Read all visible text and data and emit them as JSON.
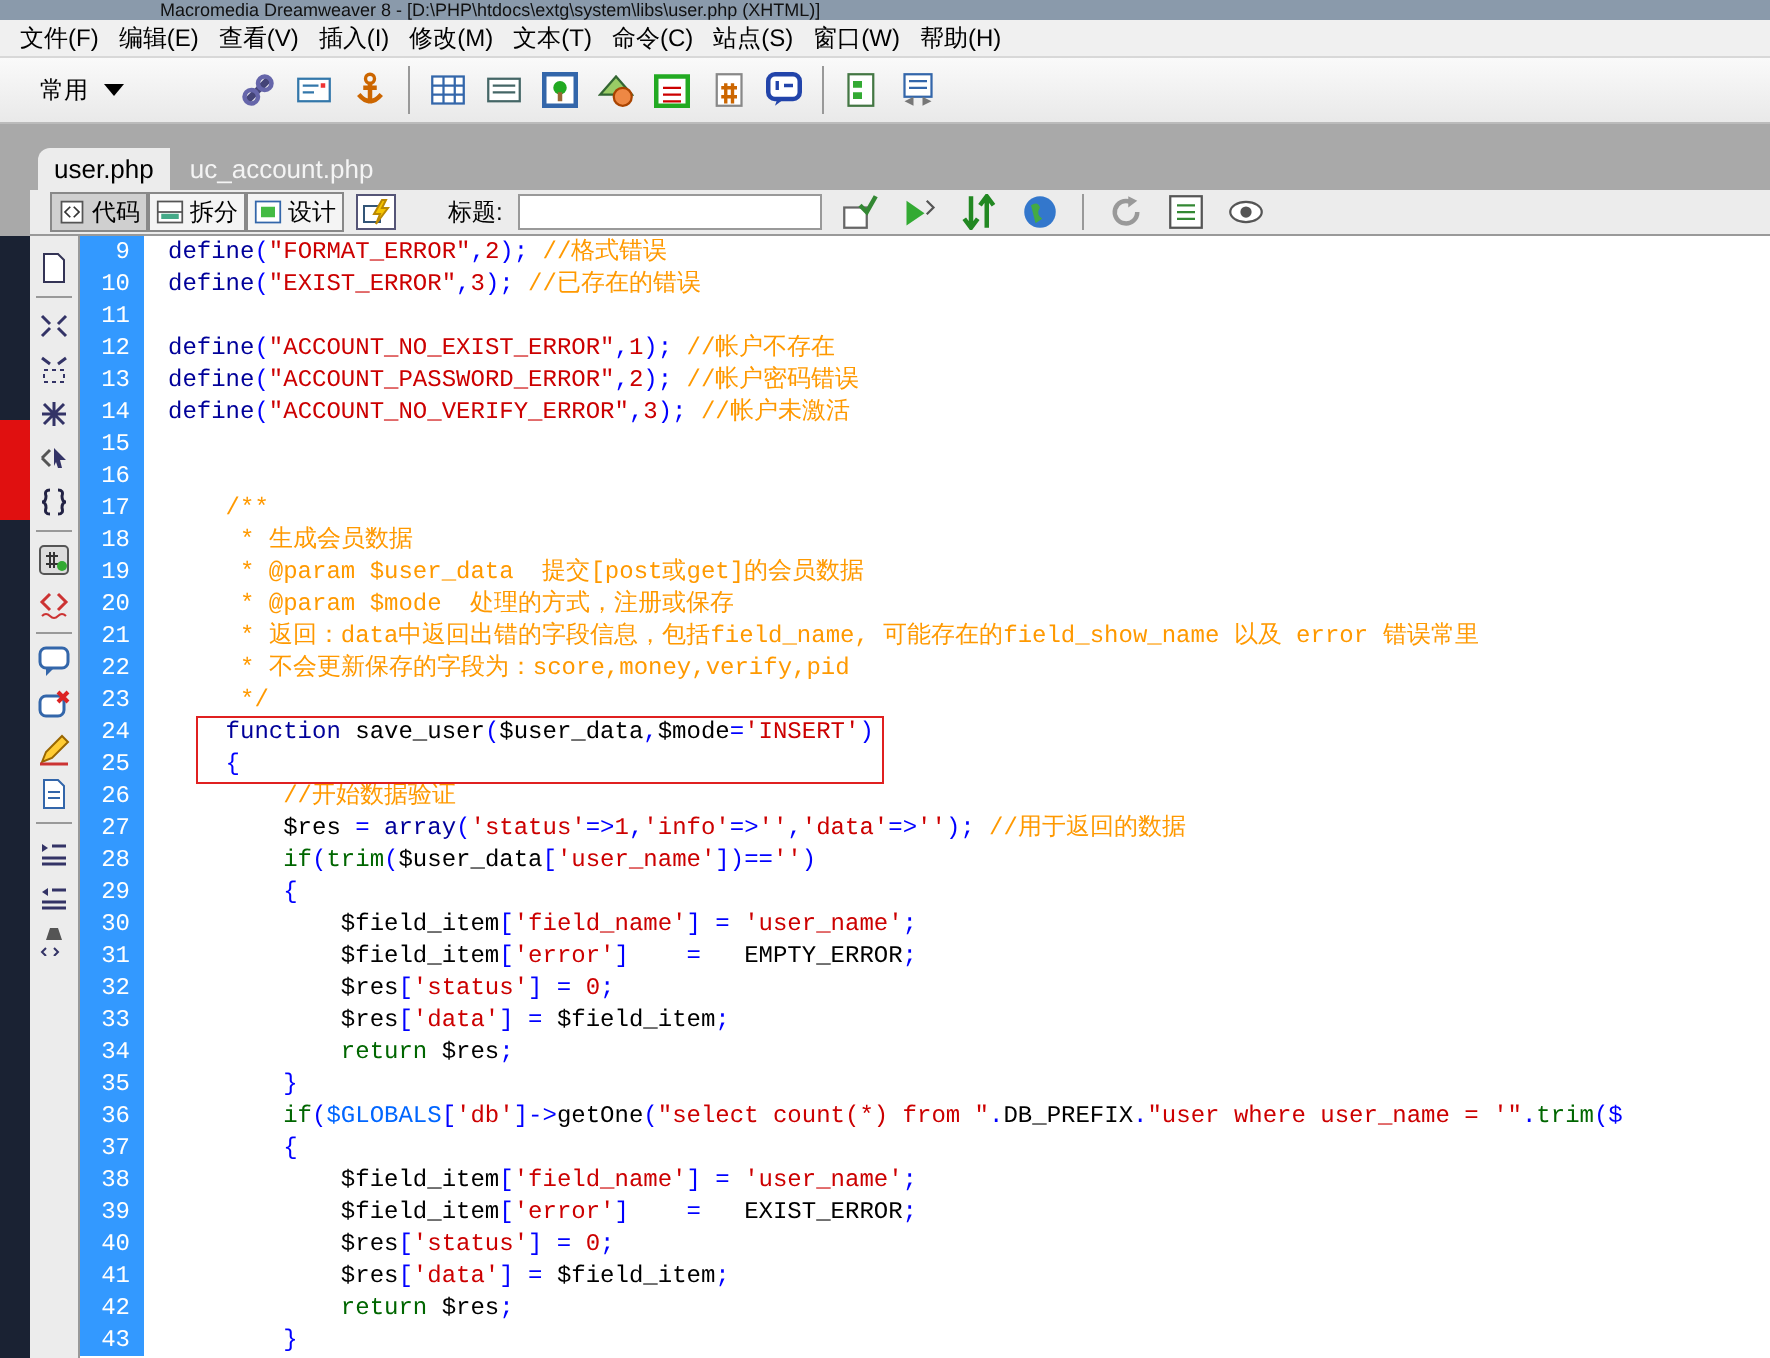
{
  "title_bar": {
    "title": "Macromedia Dreamweaver 8 - [D:\\PHP\\htdocs\\extg\\system\\libs\\user.php (XHTML)]"
  },
  "menu": [
    "文件(F)",
    "编辑(E)",
    "查看(V)",
    "插入(I)",
    "修改(M)",
    "文本(T)",
    "命令(C)",
    "站点(S)",
    "窗口(W)",
    "帮助(H)"
  ],
  "insert_bar": {
    "category": "常用"
  },
  "tabs": [
    {
      "label": "user.php",
      "selected": true
    },
    {
      "label": "uc_account.php",
      "selected": false
    }
  ],
  "view_buttons": [
    {
      "label": "代码",
      "selected": true
    },
    {
      "label": "拆分",
      "selected": false
    },
    {
      "label": "设计",
      "selected": false
    }
  ],
  "title_field": {
    "label": "标题:"
  },
  "code": {
    "lines": [
      {
        "number": "9",
        "tokens": [
          {
            "kind": "k",
            "text": "define"
          },
          {
            "kind": "p",
            "text": "("
          },
          {
            "kind": "s",
            "text": "\"FORMAT_ERROR\""
          },
          {
            "kind": "p",
            "text": ","
          },
          {
            "kind": "n",
            "text": "2"
          },
          {
            "kind": "p",
            "text": ");"
          },
          {
            "kind": "c",
            "text": " //格式错误"
          }
        ]
      },
      {
        "number": "10",
        "tokens": [
          {
            "kind": "k",
            "text": "define"
          },
          {
            "kind": "p",
            "text": "("
          },
          {
            "kind": "s",
            "text": "\"EXIST_ERROR\""
          },
          {
            "kind": "p",
            "text": ","
          },
          {
            "kind": "n",
            "text": "3"
          },
          {
            "kind": "p",
            "text": ");"
          },
          {
            "kind": "c",
            "text": " //已存在的错误"
          }
        ]
      },
      {
        "number": "11"
      },
      {
        "number": "12",
        "tokens": [
          {
            "kind": "k",
            "text": "define"
          },
          {
            "kind": "p",
            "text": "("
          },
          {
            "kind": "s",
            "text": "\"ACCOUNT_NO_EXIST_ERROR\""
          },
          {
            "kind": "p",
            "text": ","
          },
          {
            "kind": "n",
            "text": "1"
          },
          {
            "kind": "p",
            "text": ");"
          },
          {
            "kind": "c",
            "text": " //帐户不存在"
          }
        ]
      },
      {
        "number": "13",
        "tokens": [
          {
            "kind": "k",
            "text": "define"
          },
          {
            "kind": "p",
            "text": "("
          },
          {
            "kind": "s",
            "text": "\"ACCOUNT_PASSWORD_ERROR\""
          },
          {
            "kind": "p",
            "text": ","
          },
          {
            "kind": "n",
            "text": "2"
          },
          {
            "kind": "p",
            "text": ");"
          },
          {
            "kind": "c",
            "text": " //帐户密码错误"
          }
        ]
      },
      {
        "number": "14",
        "tokens": [
          {
            "kind": "k",
            "text": "define"
          },
          {
            "kind": "p",
            "text": "("
          },
          {
            "kind": "s",
            "text": "\"ACCOUNT_NO_VERIFY_ERROR\""
          },
          {
            "kind": "p",
            "text": ","
          },
          {
            "kind": "n",
            "text": "3"
          },
          {
            "kind": "p",
            "text": ");"
          },
          {
            "kind": "c",
            "text": " //帐户未激活"
          }
        ]
      },
      {
        "number": "15"
      },
      {
        "number": "16"
      },
      {
        "number": "17",
        "tokens": [
          {
            "kind": "c",
            "text": "    /**"
          }
        ]
      },
      {
        "number": "18",
        "tokens": [
          {
            "kind": "c",
            "text": "     * 生成会员数据"
          }
        ]
      },
      {
        "number": "19",
        "tokens": [
          {
            "kind": "c",
            "text": "     * @param $user_data  提交[post或get]的会员数据"
          }
        ]
      },
      {
        "number": "20",
        "tokens": [
          {
            "kind": "c",
            "text": "     * @param $mode  处理的方式，注册或保存"
          }
        ]
      },
      {
        "number": "21",
        "tokens": [
          {
            "kind": "c",
            "text": "     * 返回：data中返回出错的字段信息，包括field_name, 可能存在的field_show_name 以及 error 错误常里"
          }
        ]
      },
      {
        "number": "22",
        "tokens": [
          {
            "kind": "c",
            "text": "     * 不会更新保存的字段为：score,money,verify,pid"
          }
        ]
      },
      {
        "number": "23",
        "tokens": [
          {
            "kind": "c",
            "text": "     */"
          }
        ]
      },
      {
        "number": "24",
        "tokens": [
          {
            "kind": "k",
            "text": "    function"
          },
          {
            "kind": "t",
            "text": " save_user"
          },
          {
            "kind": "p",
            "text": "("
          },
          {
            "kind": "t",
            "text": "$user_data"
          },
          {
            "kind": "p",
            "text": ","
          },
          {
            "kind": "t",
            "text": "$mode"
          },
          {
            "kind": "p",
            "text": "="
          },
          {
            "kind": "s",
            "text": "'INSERT'"
          },
          {
            "kind": "p",
            "text": ")"
          }
        ]
      },
      {
        "number": "25",
        "tokens": [
          {
            "kind": "p",
            "text": "    {"
          }
        ]
      },
      {
        "number": "26",
        "tokens": [
          {
            "kind": "c",
            "text": "        //开始数据验证"
          }
        ]
      },
      {
        "number": "27",
        "tokens": [
          {
            "kind": "t",
            "text": "        $res "
          },
          {
            "kind": "p",
            "text": "= "
          },
          {
            "kind": "k",
            "text": "array"
          },
          {
            "kind": "p",
            "text": "("
          },
          {
            "kind": "s",
            "text": "'status'"
          },
          {
            "kind": "p",
            "text": "=>"
          },
          {
            "kind": "n",
            "text": "1"
          },
          {
            "kind": "p",
            "text": ","
          },
          {
            "kind": "s",
            "text": "'info'"
          },
          {
            "kind": "p",
            "text": "=>"
          },
          {
            "kind": "s",
            "text": "''"
          },
          {
            "kind": "p",
            "text": ","
          },
          {
            "kind": "s",
            "text": "'data'"
          },
          {
            "kind": "p",
            "text": "=>"
          },
          {
            "kind": "s",
            "text": "''"
          },
          {
            "kind": "p",
            "text": ");"
          },
          {
            "kind": "c",
            "text": " //用于返回的数据"
          }
        ]
      },
      {
        "number": "28",
        "tokens": [
          {
            "kind": "g",
            "text": "        if"
          },
          {
            "kind": "p",
            "text": "("
          },
          {
            "kind": "g",
            "text": "trim"
          },
          {
            "kind": "p",
            "text": "("
          },
          {
            "kind": "t",
            "text": "$user_data"
          },
          {
            "kind": "p",
            "text": "["
          },
          {
            "kind": "s",
            "text": "'user_name'"
          },
          {
            "kind": "p",
            "text": "])=="
          },
          {
            "kind": "s",
            "text": "''"
          },
          {
            "kind": "p",
            "text": ")"
          }
        ]
      },
      {
        "number": "29",
        "tokens": [
          {
            "kind": "p",
            "text": "        {"
          }
        ]
      },
      {
        "number": "30",
        "tokens": [
          {
            "kind": "t",
            "text": "            $field_item"
          },
          {
            "kind": "p",
            "text": "["
          },
          {
            "kind": "s",
            "text": "'field_name'"
          },
          {
            "kind": "p",
            "text": "] = "
          },
          {
            "kind": "s",
            "text": "'user_name'"
          },
          {
            "kind": "p",
            "text": ";"
          }
        ]
      },
      {
        "number": "31",
        "tokens": [
          {
            "kind": "t",
            "text": "            $field_item"
          },
          {
            "kind": "p",
            "text": "["
          },
          {
            "kind": "s",
            "text": "'error'"
          },
          {
            "kind": "p",
            "text": "]    =   "
          },
          {
            "kind": "t",
            "text": "EMPTY_ERROR"
          },
          {
            "kind": "p",
            "text": ";"
          }
        ]
      },
      {
        "number": "32",
        "tokens": [
          {
            "kind": "t",
            "text": "            $res"
          },
          {
            "kind": "p",
            "text": "["
          },
          {
            "kind": "s",
            "text": "'status'"
          },
          {
            "kind": "p",
            "text": "] = "
          },
          {
            "kind": "n",
            "text": "0"
          },
          {
            "kind": "p",
            "text": ";"
          }
        ]
      },
      {
        "number": "33",
        "tokens": [
          {
            "kind": "t",
            "text": "            $res"
          },
          {
            "kind": "p",
            "text": "["
          },
          {
            "kind": "s",
            "text": "'data'"
          },
          {
            "kind": "p",
            "text": "] = "
          },
          {
            "kind": "t",
            "text": "$field_item"
          },
          {
            "kind": "p",
            "text": ";"
          }
        ]
      },
      {
        "number": "34",
        "tokens": [
          {
            "kind": "g",
            "text": "            return"
          },
          {
            "kind": "t",
            "text": " $res"
          },
          {
            "kind": "p",
            "text": ";"
          }
        ]
      },
      {
        "number": "35",
        "tokens": [
          {
            "kind": "p",
            "text": "        }"
          }
        ]
      },
      {
        "number": "36",
        "tokens": [
          {
            "kind": "g",
            "text": "        if"
          },
          {
            "kind": "p",
            "text": "("
          },
          {
            "kind": "v",
            "text": "$GLOBALS"
          },
          {
            "kind": "p",
            "text": "["
          },
          {
            "kind": "s",
            "text": "'db'"
          },
          {
            "kind": "p",
            "text": "]->"
          },
          {
            "kind": "t",
            "text": "getOne"
          },
          {
            "kind": "p",
            "text": "("
          },
          {
            "kind": "s",
            "text": "\"select count(*) from \""
          },
          {
            "kind": "p",
            "text": "."
          },
          {
            "kind": "t",
            "text": "DB_PREFIX"
          },
          {
            "kind": "p",
            "text": "."
          },
          {
            "kind": "s",
            "text": "\"user where user_name = '\""
          },
          {
            "kind": "p",
            "text": "."
          },
          {
            "kind": "g",
            "text": "trim"
          },
          {
            "kind": "p",
            "text": "($"
          }
        ]
      },
      {
        "number": "37",
        "tokens": [
          {
            "kind": "p",
            "text": "        {"
          }
        ]
      },
      {
        "number": "38",
        "tokens": [
          {
            "kind": "t",
            "text": "            $field_item"
          },
          {
            "kind": "p",
            "text": "["
          },
          {
            "kind": "s",
            "text": "'field_name'"
          },
          {
            "kind": "p",
            "text": "] = "
          },
          {
            "kind": "s",
            "text": "'user_name'"
          },
          {
            "kind": "p",
            "text": ";"
          }
        ]
      },
      {
        "number": "39",
        "tokens": [
          {
            "kind": "t",
            "text": "            $field_item"
          },
          {
            "kind": "p",
            "text": "["
          },
          {
            "kind": "s",
            "text": "'error'"
          },
          {
            "kind": "p",
            "text": "]    =   "
          },
          {
            "kind": "t",
            "text": "EXIST_ERROR"
          },
          {
            "kind": "p",
            "text": ";"
          }
        ]
      },
      {
        "number": "40",
        "tokens": [
          {
            "kind": "t",
            "text": "            $res"
          },
          {
            "kind": "p",
            "text": "["
          },
          {
            "kind": "s",
            "text": "'status'"
          },
          {
            "kind": "p",
            "text": "] = "
          },
          {
            "kind": "n",
            "text": "0"
          },
          {
            "kind": "p",
            "text": ";"
          }
        ]
      },
      {
        "number": "41",
        "tokens": [
          {
            "kind": "t",
            "text": "            $res"
          },
          {
            "kind": "p",
            "text": "["
          },
          {
            "kind": "s",
            "text": "'data'"
          },
          {
            "kind": "p",
            "text": "] = "
          },
          {
            "kind": "t",
            "text": "$field_item"
          },
          {
            "kind": "p",
            "text": ";"
          }
        ]
      },
      {
        "number": "42",
        "tokens": [
          {
            "kind": "g",
            "text": "            return"
          },
          {
            "kind": "t",
            "text": " $res"
          },
          {
            "kind": "p",
            "text": ";"
          }
        ]
      },
      {
        "number": "43",
        "tokens": [
          {
            "kind": "p",
            "text": "        }"
          }
        ]
      }
    ]
  }
}
